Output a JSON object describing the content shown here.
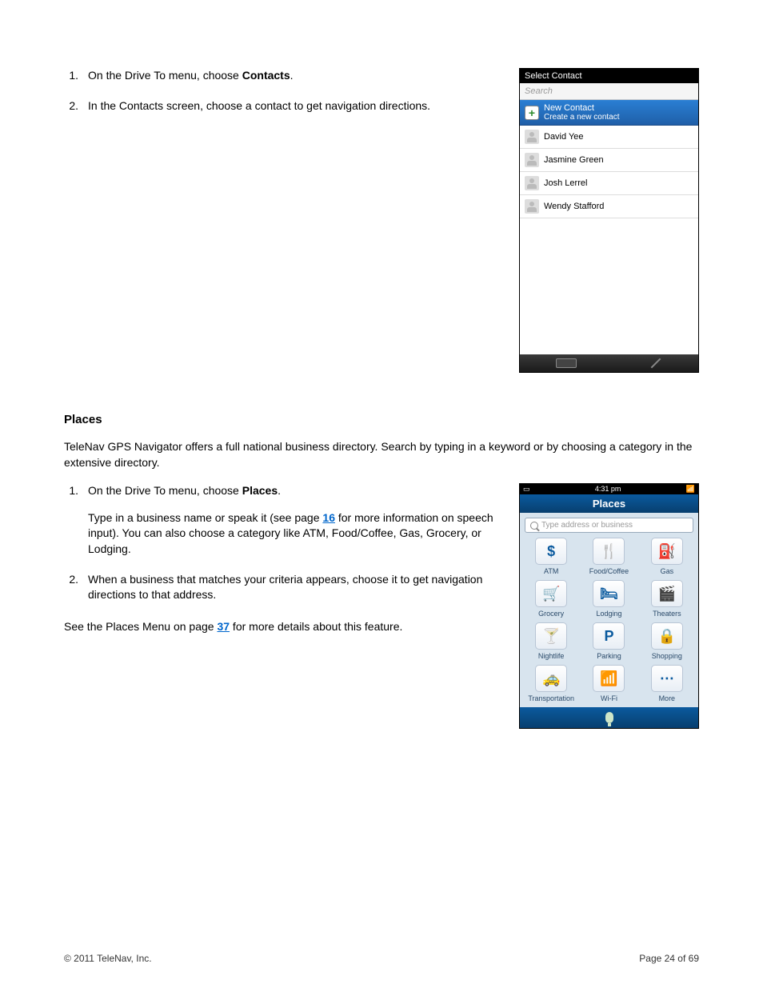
{
  "steps_a": [
    {
      "num": "1.",
      "pre": "On the Drive To menu, choose ",
      "bold": "Contacts",
      "post": "."
    },
    {
      "num": "2.",
      "pre": "In the Contacts screen, choose a contact to get navigation directions.",
      "bold": "",
      "post": ""
    }
  ],
  "contact_shot": {
    "title": "Select Contact",
    "search_placeholder": "Search",
    "new_contact": {
      "title": "New Contact",
      "sub": "Create a new contact"
    },
    "contacts": [
      "David Yee",
      "Jasmine Green",
      "Josh Lerrel",
      "Wendy Stafford"
    ]
  },
  "places_heading": "Places",
  "places_intro": "TeleNav GPS Navigator offers a full national business directory. Search by typing in a keyword or by choosing a category in the extensive directory.",
  "steps_b": [
    {
      "num": "1.",
      "pre": "On the Drive To menu, choose ",
      "bold": "Places",
      "post": ".",
      "sub_pre": "Type in a business name or speak it (see page ",
      "sub_link": "16",
      "sub_post": " for more information on speech input). You can also choose a category like ATM, Food/Coffee, Gas, Grocery, or Lodging."
    },
    {
      "num": "2.",
      "pre": "When a business that matches your criteria appears, choose it to get navigation directions to that address.",
      "bold": "",
      "post": ""
    }
  ],
  "seealso_pre": "See the Places Menu on page ",
  "seealso_link": "37",
  "seealso_post": " for more details about this feature.",
  "places_shot": {
    "status_time": "4:31 pm",
    "title": "Places",
    "search_placeholder": "Type address or business",
    "cells": [
      {
        "glyph": "$",
        "label": "ATM"
      },
      {
        "glyph": "🍴",
        "label": "Food/Coffee"
      },
      {
        "glyph": "⛽",
        "label": "Gas"
      },
      {
        "glyph": "🛒",
        "label": "Grocery"
      },
      {
        "glyph": "🛏",
        "label": "Lodging"
      },
      {
        "glyph": "🎬",
        "label": "Theaters"
      },
      {
        "glyph": "🍸",
        "label": "Nightlife"
      },
      {
        "glyph": "P",
        "label": "Parking"
      },
      {
        "glyph": "🔒",
        "label": "Shopping"
      },
      {
        "glyph": "🚕",
        "label": "Transportation"
      },
      {
        "glyph": "📶",
        "label": "Wi-Fi"
      },
      {
        "glyph": "⋯",
        "label": "More"
      }
    ]
  },
  "footer": {
    "copyright": "© 2011 TeleNav, Inc.",
    "page": "Page 24 of 69"
  }
}
